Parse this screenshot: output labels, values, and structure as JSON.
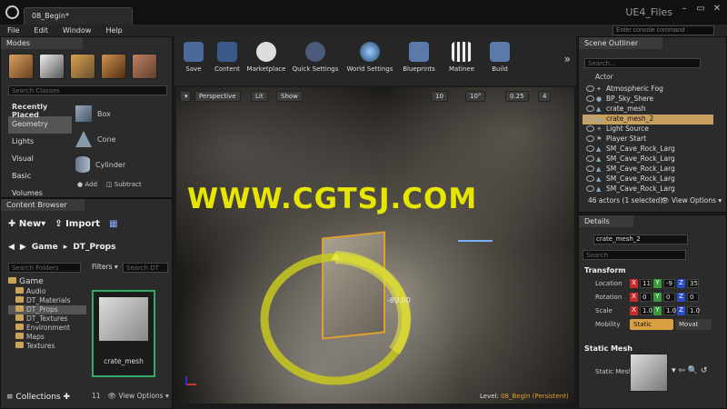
{
  "window": {
    "tab_title": "08_Begin*",
    "project_name": "UE4_Files"
  },
  "menu": [
    "File",
    "Edit",
    "Window",
    "Help"
  ],
  "command": {
    "placeholder": "Enter console command"
  },
  "modes": {
    "tab": "Modes",
    "search_placeholder": "Search Classes",
    "categories": [
      "Recently Placed",
      "Geometry",
      "Lights",
      "Visual",
      "Basic",
      "Volumes"
    ],
    "items": [
      "Box",
      "Cone",
      "Cylinder"
    ],
    "add_label": "Add",
    "subtract_label": "Subtract"
  },
  "toolbar": [
    "Save",
    "Content",
    "Marketplace",
    "Quick Settings",
    "World Settings",
    "Blueprints",
    "Matinee",
    "Build"
  ],
  "viewport": {
    "perspective": "Perspective",
    "lit": "Lit",
    "show": "Show",
    "grid_snap": "10",
    "rot_snap": "10°",
    "scale_snap": "0.25",
    "cam_speed": "4",
    "rotation_readout": "-80.00",
    "level_label": "Level:",
    "level_name": "08_Begin (Persistent)",
    "watermark": "WWW.CGTSJ.COM"
  },
  "content_browser": {
    "tab": "Content Browser",
    "new_label": "New",
    "import_label": "Import",
    "path": [
      "Game",
      "DT_Props"
    ],
    "search_folders": "Search Folders",
    "filters_label": "Filters",
    "search_dt": "Search DT",
    "folders": [
      {
        "name": "Game",
        "level": 0
      },
      {
        "name": "Audio",
        "level": 1
      },
      {
        "name": "DT_Materials",
        "level": 1
      },
      {
        "name": "DT_Props",
        "level": 1
      },
      {
        "name": "DT_Textures",
        "level": 1
      },
      {
        "name": "Environment",
        "level": 1
      },
      {
        "name": "Maps",
        "level": 1
      },
      {
        "name": "Textures",
        "level": 1
      }
    ],
    "asset_name": "crate_mesh",
    "item_count": "11",
    "view_options": "View Options",
    "collections": "Collections"
  },
  "outliner": {
    "tab": "Scene Outliner",
    "search_placeholder": "Search...",
    "column": "Actor",
    "rows": [
      "Atmospheric Fog",
      "BP_Sky_Shere",
      "crate_mesh",
      "crate_mesh_2",
      "Light Source",
      "Player Start",
      "SM_Cave_Rock_Larg",
      "SM_Cave_Rock_Larg",
      "SM_Cave_Rock_Larg",
      "SM_Cave_Rock_Larg",
      "SM_Cave_Rock_Larg"
    ],
    "selected_index": 3,
    "status": "46 actors (1 selected)",
    "view_options": "View Options"
  },
  "details": {
    "tab": "Details",
    "name": "crate_mesh_2",
    "search_placeholder": "Search",
    "transform_header": "Transform",
    "location_label": "Location",
    "rotation_label": "Rotation",
    "scale_label": "Scale",
    "mobility_label": "Mobility",
    "location": [
      "11",
      "-9",
      "35"
    ],
    "rotation": [
      "0",
      "0",
      "0"
    ],
    "scale": [
      "1.0",
      "1.0",
      "1.0"
    ],
    "mobility_static": "Static",
    "mobility_movable": "Movat",
    "static_mesh_header": "Static Mesh",
    "static_mesh_label": "Static Mesh"
  },
  "colors": {
    "accent": "#f0c060",
    "selection": "#c8a060",
    "x_axis": "#c62a2a",
    "y_axis": "#3a9a3a",
    "z_axis": "#2a4ac6"
  }
}
